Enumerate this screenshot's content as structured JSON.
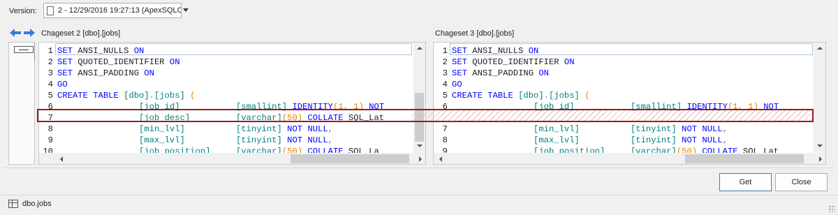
{
  "version": {
    "label": "Version:",
    "selected": "2 - 12/29/2016 19:27:13 (ApexSQLC"
  },
  "left": {
    "title": "Chageset 2 [dbo].[jobs]",
    "lines": [
      {
        "n": "1",
        "segs": [
          [
            "kw",
            "SET"
          ],
          [
            "",
            "ANSI_NULLS"
          ],
          [
            "kw",
            " ON"
          ]
        ]
      },
      {
        "n": "2",
        "segs": [
          [
            "kw",
            "SET"
          ],
          [
            "",
            "QUOTED_IDENTIFIER"
          ],
          [
            "kw",
            " ON"
          ]
        ]
      },
      {
        "n": "3",
        "segs": [
          [
            "kw",
            "SET"
          ],
          [
            "",
            "ANSI_PADDING"
          ],
          [
            "kw",
            " ON"
          ]
        ]
      },
      {
        "n": "4",
        "segs": [
          [
            "kw",
            "GO"
          ]
        ]
      },
      {
        "n": "5",
        "segs": [
          [
            "kw",
            "CREATE TABLE"
          ],
          [
            "ty",
            " [dbo]"
          ],
          [
            "gr",
            "."
          ],
          [
            "ty",
            "[jobs]"
          ],
          [
            "nm",
            " ("
          ]
        ]
      },
      {
        "n": "6",
        "segs": [
          [
            "ty",
            "                [job id]"
          ],
          [
            "ty",
            "           [smallint]"
          ],
          [
            "kw",
            " IDENTITY"
          ],
          [
            "nm",
            "("
          ],
          [
            "nm",
            "1"
          ],
          [
            "gr",
            ", "
          ],
          [
            "nm",
            "1"
          ],
          [
            "nm",
            ")"
          ],
          [
            "kw",
            " NOT"
          ]
        ]
      },
      {
        "n": "7",
        "segs": [
          [
            "ty",
            "                [job desc]"
          ],
          [
            "ty",
            "         [varchar]"
          ],
          [
            "nm",
            "(50)"
          ],
          [
            "kw",
            " COLLATE"
          ],
          [
            "",
            "SQL_Lat"
          ]
        ]
      },
      {
        "n": "8",
        "segs": [
          [
            "ty",
            "                [min_lvl]"
          ],
          [
            "ty",
            "          [tinyint]"
          ],
          [
            "kw",
            " NOT NULL"
          ],
          [
            "gr",
            ","
          ]
        ]
      },
      {
        "n": "9",
        "segs": [
          [
            "ty",
            "                [max_lvl]"
          ],
          [
            "ty",
            "          [tinyint]"
          ],
          [
            "kw",
            " NOT NULL"
          ],
          [
            "gr",
            ","
          ]
        ]
      },
      {
        "n": "10",
        "segs": [
          [
            "ty",
            "                [job_position]"
          ],
          [
            "ty",
            "     [varchar]"
          ],
          [
            "nm",
            "(50)"
          ],
          [
            "kw",
            " COLLATE"
          ],
          [
            "",
            "SQL_La"
          ]
        ]
      }
    ]
  },
  "right": {
    "title": "Chageset 3 [dbo].[jobs]",
    "lines": [
      {
        "n": "1",
        "segs": [
          [
            "kw",
            "SET"
          ],
          [
            "",
            "ANSI_NULLS"
          ],
          [
            "kw",
            " ON"
          ]
        ]
      },
      {
        "n": "2",
        "segs": [
          [
            "kw",
            "SET"
          ],
          [
            "",
            "QUOTED_IDENTIFIER"
          ],
          [
            "kw",
            " ON"
          ]
        ]
      },
      {
        "n": "3",
        "segs": [
          [
            "kw",
            "SET"
          ],
          [
            "",
            "ANSI_PADDING"
          ],
          [
            "kw",
            " ON"
          ]
        ]
      },
      {
        "n": "4",
        "segs": [
          [
            "kw",
            "GO"
          ]
        ]
      },
      {
        "n": "5",
        "segs": [
          [
            "kw",
            "CREATE TABLE"
          ],
          [
            "ty",
            " [dbo]"
          ],
          [
            "gr",
            "."
          ],
          [
            "ty",
            "[jobs]"
          ],
          [
            "nm",
            " ("
          ]
        ]
      },
      {
        "n": "6",
        "segs": [
          [
            "ty",
            "                [job id]"
          ],
          [
            "ty",
            "           [smallint]"
          ],
          [
            "kw",
            " IDENTITY"
          ],
          [
            "nm",
            "("
          ],
          [
            "nm",
            "1"
          ],
          [
            "gr",
            ", "
          ],
          [
            "nm",
            "1"
          ],
          [
            "nm",
            ")"
          ],
          [
            "kw",
            " NOT"
          ]
        ]
      },
      {
        "n": "",
        "segs": []
      },
      {
        "n": "7",
        "segs": [
          [
            "ty",
            "                [min_lvl]"
          ],
          [
            "ty",
            "          [tinyint]"
          ],
          [
            "kw",
            " NOT NULL"
          ],
          [
            "gr",
            ","
          ]
        ]
      },
      {
        "n": "8",
        "segs": [
          [
            "ty",
            "                [max_lvl]"
          ],
          [
            "ty",
            "          [tinyint]"
          ],
          [
            "kw",
            " NOT NULL"
          ],
          [
            "gr",
            ","
          ]
        ]
      },
      {
        "n": "9",
        "segs": [
          [
            "ty",
            "                [job_position]"
          ],
          [
            "ty",
            "     [varchar]"
          ],
          [
            "nm",
            "(50)"
          ],
          [
            "kw",
            " COLLATE"
          ],
          [
            "",
            "SQL_Lat"
          ]
        ]
      }
    ]
  },
  "buttons": {
    "get": "Get",
    "close": "Close"
  },
  "status": {
    "text": "dbo.jobs"
  },
  "colors": {
    "diff_border": "#9b1b1b",
    "accent": "#3c7fb1",
    "keyword": "#0000ff",
    "type": "#008080",
    "number": "#e08000"
  },
  "icons": {
    "back": "arrow-left-icon",
    "forward": "arrow-right-icon",
    "status": "table-icon",
    "document": "document-icon"
  }
}
